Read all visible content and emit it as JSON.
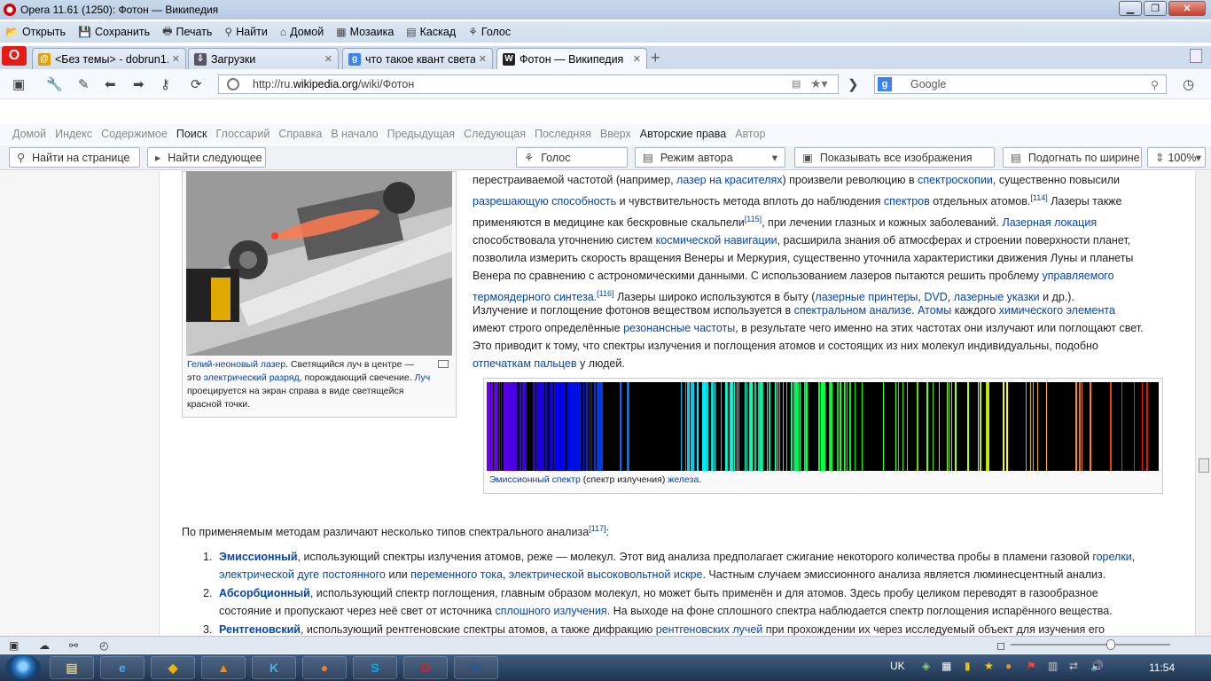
{
  "window": {
    "title": "Opera 11.61 (1250): Фотон — Википедия"
  },
  "menu": [
    {
      "icon": "open-icon",
      "label": "Открыть",
      "glyph": "📂"
    },
    {
      "icon": "save-icon",
      "label": "Сохранить",
      "glyph": "💾"
    },
    {
      "icon": "print-icon",
      "label": "Печать",
      "glyph": "🖶"
    },
    {
      "icon": "find-icon",
      "label": "Найти",
      "glyph": "⚲"
    },
    {
      "icon": "home-icon",
      "label": "Домой",
      "glyph": "⌂"
    },
    {
      "icon": "tile-icon",
      "label": "Мозаика",
      "glyph": "▦"
    },
    {
      "icon": "cascade-icon",
      "label": "Каскад",
      "glyph": "▤"
    },
    {
      "icon": "voice-icon",
      "label": "Голос",
      "glyph": "⚘"
    }
  ],
  "tabs": [
    {
      "label": "<Без темы> - dobrun1...",
      "favicon_color": "#e8a000",
      "favicon": "@"
    },
    {
      "label": "Загрузки",
      "favicon_color": "#556",
      "favicon": "⇩"
    },
    {
      "label": "что такое квант света ...",
      "favicon_color": "#3b82f6",
      "favicon": "g"
    },
    {
      "label": "Фотон — Википедия",
      "favicon_color": "#222",
      "favicon": "W"
    }
  ],
  "address": {
    "prefix": "http://ru.",
    "host": "wikipedia.org",
    "path": "/wiki/Фотон"
  },
  "search": {
    "engine": "Google",
    "placeholder": "Google"
  },
  "linkbar": [
    "Домой",
    "Индекс",
    "Содержимое",
    "Поиск",
    "Глоссарий",
    "Справка",
    "В начало",
    "Предыдущая",
    "Следующая",
    "Последняя",
    "Вверх",
    "Авторские права",
    "Автор"
  ],
  "findbar": {
    "find_placeholder": "Найти на странице",
    "find_next": "Найти следующее",
    "voice": "Голос",
    "author_mode": "Режим автора",
    "show_images": "Показывать все изображения",
    "fit_width": "Подогнать по ширине",
    "zoom": "100%"
  },
  "article": {
    "p1_lines": [
      [
        "перестраиваемой частотой (например, ",
        {
          "a": "лазер на красителях"
        },
        ") произвели революцию в ",
        {
          "a": "спектроскопии"
        },
        ", существенно повысили"
      ],
      [
        {
          "a": "разрешающую способность"
        },
        " и чувствительность метода вплоть до наблюдения ",
        {
          "a": "спектров"
        },
        " отдельных атомов.",
        {
          "sup": "[114]"
        },
        " Лазеры также"
      ],
      [
        "применяются в медицине как бескровные скальпели",
        {
          "sup": "[115]"
        },
        ", при лечении глазных и кожных заболеваний. ",
        {
          "a": "Лазерная локация"
        }
      ],
      [
        "способствовала уточнению систем ",
        {
          "a": "космической навигации"
        },
        ", расширила знания об атмосферах и строении поверхности планет,"
      ],
      [
        "позволила измерить скорость вращения Венеры и Меркурия, существенно уточнила характеристики движения Луны и планеты"
      ],
      [
        "Венера по сравнению с астрономическими данными. С использованием лазеров пытаются решить проблему ",
        {
          "a": "управляемого"
        }
      ],
      [
        {
          "a": "термоядерного синтеза"
        },
        ".",
        {
          "sup": "[116]"
        },
        " Лазеры широко используются в быту (",
        {
          "a": "лазерные принтеры"
        },
        ", ",
        {
          "a": "DVD"
        },
        ", ",
        {
          "a": "лазерные указки"
        },
        " и др.)."
      ]
    ],
    "p2_lines": [
      [
        "Излучение и поглощение фотонов веществом используется в ",
        {
          "a": "спектральном анализе"
        },
        ". ",
        {
          "a": "Атомы"
        },
        " каждого ",
        {
          "a": "химического элемента"
        }
      ],
      [
        "имеют строго определённые ",
        {
          "a": "резонансные частоты"
        },
        ", в результате чего именно на этих частотах они излучают или поглощают свет."
      ],
      [
        "Это приводит к тому, что спектры излучения и поглощения атомов и состоящих из них молекул индивидуальны, подобно"
      ],
      [
        {
          "a": "отпечаткам пальцев"
        },
        " у людей."
      ]
    ],
    "thumb_caption": [
      [
        {
          "a": "Гелий-неоновый лазер"
        },
        ". Светящийся луч в центре —"
      ],
      [
        "это ",
        {
          "a": "электрический разряд"
        },
        ", порождающий свечение. ",
        {
          "a": "Луч"
        }
      ],
      [
        "проецируется на экран справа в виде светящейся"
      ],
      [
        "красной точки."
      ]
    ],
    "spectrum_caption": [
      {
        "a": "Эмиссионный спектр"
      },
      " (спектр излучения) ",
      {
        "a": "железа"
      },
      "."
    ],
    "intro": [
      "По применяемым методам различают несколько типов спектрального анализа",
      {
        "sup": "[117]"
      },
      ":"
    ],
    "list": [
      {
        "num": "1.",
        "lines": [
          [
            {
              "b": "Эмиссионный"
            },
            ", использующий спектры излучения атомов, реже — молекул. Этот вид анализа предполагает сжигание некоторого количества пробы в пламени газовой ",
            {
              "a": "горелки"
            },
            ","
          ],
          [
            {
              "a": "электрической дуге постоянного"
            },
            " или ",
            {
              "a": "переменного тока"
            },
            ", ",
            {
              "a": "электрической высоковольтной искре"
            },
            ". Частным случаем эмиссионного анализа является люминесцентный анализ."
          ]
        ]
      },
      {
        "num": "2.",
        "lines": [
          [
            {
              "b": "Абсорбционный"
            },
            ", использующий спектр поглощения, главным образом молекул, но может быть применён и для атомов. Здесь пробу целиком переводят в газообразное"
          ],
          [
            "состояние и пропускают через неё свет от источника ",
            {
              "a": "сплошного излучения"
            },
            ". На выходе на фоне сплошного спектра наблюдается спектр поглощения испарённого вещества."
          ]
        ]
      },
      {
        "num": "3.",
        "lines": [
          [
            {
              "b": "Рентгеновский"
            },
            ", использующий рентгеновские спектры атомов, а также дифракцию ",
            {
              "a": "рентгеновских лучей"
            },
            " при прохождении их через исследуемый объект для изучения его"
          ]
        ]
      }
    ]
  },
  "taskbar": {
    "apps": [
      {
        "name": "explorer-icon",
        "glyph": "▤",
        "color": "#e8c060"
      },
      {
        "name": "ie-icon",
        "glyph": "e",
        "color": "#4aa3ff"
      },
      {
        "name": "app-icon",
        "glyph": "◆",
        "color": "#f0b000"
      },
      {
        "name": "vlc-icon",
        "glyph": "▲",
        "color": "#ff8a00"
      },
      {
        "name": "app2-icon",
        "glyph": "K",
        "color": "#4ab0e0"
      },
      {
        "name": "firefox-icon",
        "glyph": "●",
        "color": "#ff7a20"
      },
      {
        "name": "skype-icon",
        "glyph": "S",
        "color": "#00aff0"
      },
      {
        "name": "opera-icon",
        "glyph": "O",
        "color": "#e41b17"
      },
      {
        "name": "word-icon",
        "glyph": "W",
        "color": "#2b5797"
      }
    ],
    "lang": "UK",
    "time": "11:54"
  }
}
